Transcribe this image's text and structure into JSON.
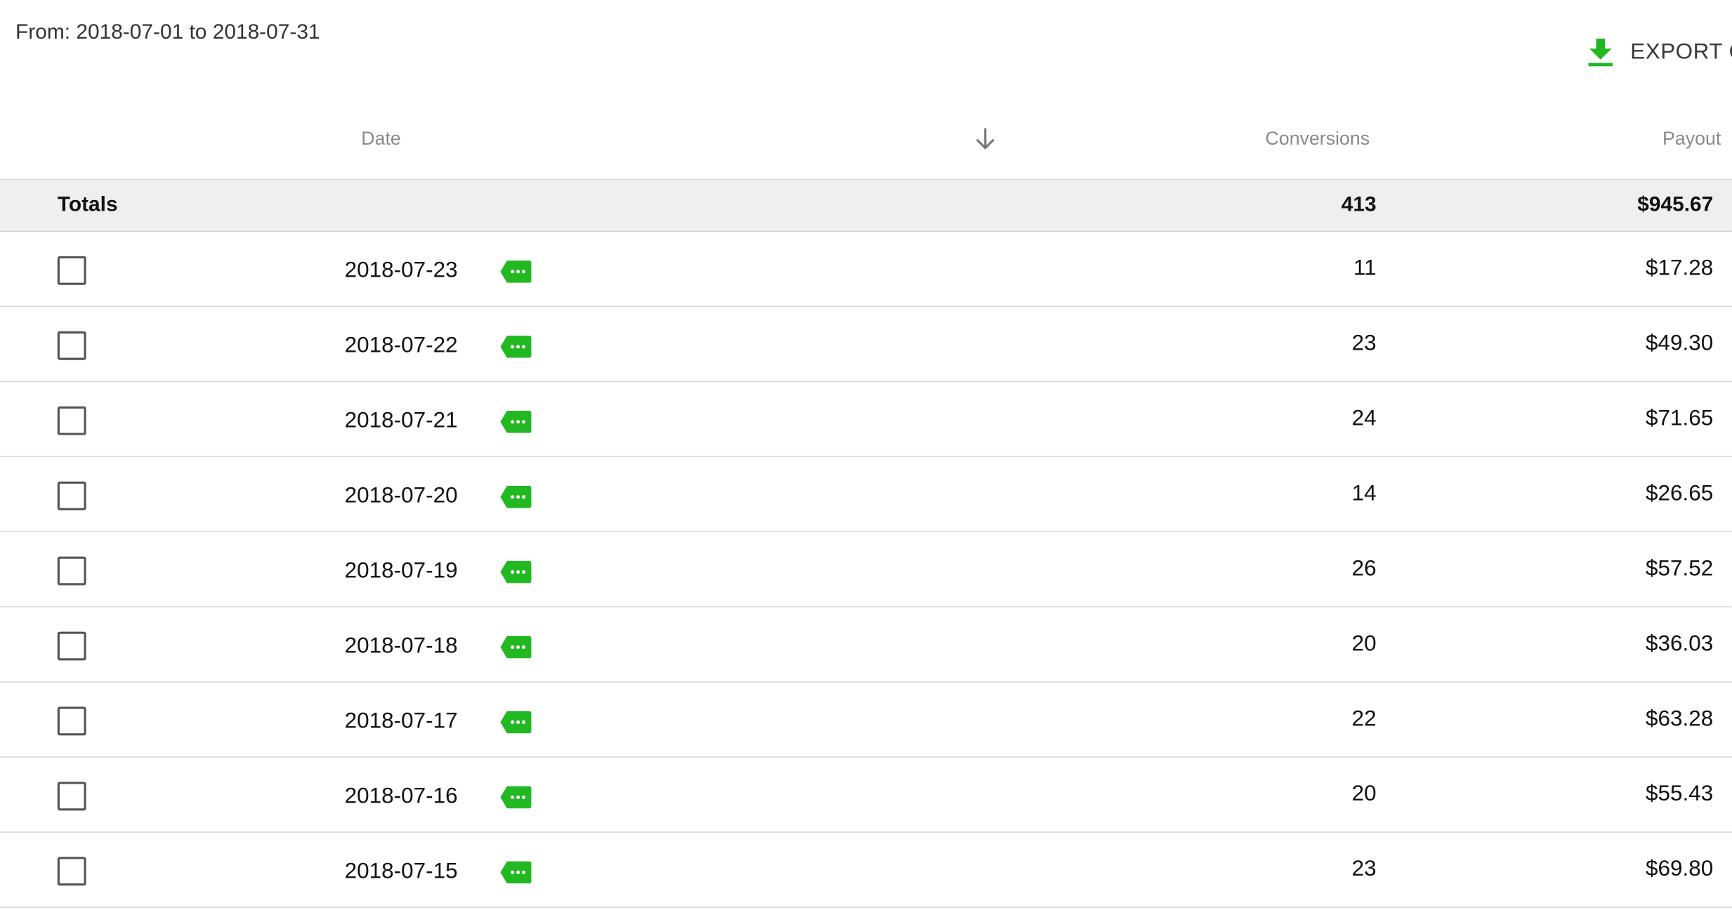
{
  "filter": {
    "range_text": "From: 2018-07-01 to 2018-07-31"
  },
  "toolbar": {
    "export_label": "EXPORT C",
    "export_icon": "download-icon",
    "accent_color": "#22b821"
  },
  "table": {
    "columns": {
      "date": "Date",
      "conversions": "Conversions",
      "payout": "Payout"
    },
    "sort_icon": "arrow-down-icon",
    "totals": {
      "label": "Totals",
      "conversions": "413",
      "payout": "$945.67"
    },
    "row_icon": "tag-more-icon",
    "rows": [
      {
        "date": "2018-07-23",
        "conversions": "11",
        "payout": "$17.28"
      },
      {
        "date": "2018-07-22",
        "conversions": "23",
        "payout": "$49.30"
      },
      {
        "date": "2018-07-21",
        "conversions": "24",
        "payout": "$71.65"
      },
      {
        "date": "2018-07-20",
        "conversions": "14",
        "payout": "$26.65"
      },
      {
        "date": "2018-07-19",
        "conversions": "26",
        "payout": "$57.52"
      },
      {
        "date": "2018-07-18",
        "conversions": "20",
        "payout": "$36.03"
      },
      {
        "date": "2018-07-17",
        "conversions": "22",
        "payout": "$63.28"
      },
      {
        "date": "2018-07-16",
        "conversions": "20",
        "payout": "$55.43"
      },
      {
        "date": "2018-07-15",
        "conversions": "23",
        "payout": "$69.80"
      }
    ]
  }
}
